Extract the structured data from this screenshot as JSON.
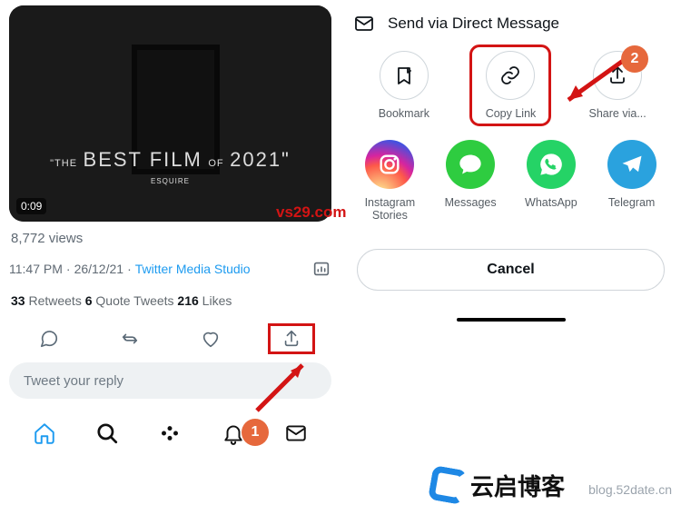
{
  "video": {
    "duration": "0:09",
    "overlay_line1": "\"THE",
    "overlay_line2": "BEST FILM",
    "overlay_line3": "OF",
    "overlay_year": "2021\"",
    "overlay_sub": "ESQUIRE"
  },
  "tweet": {
    "views": "8,772 views",
    "time": "11:47 PM",
    "sep": " · ",
    "date": "26/12/21",
    "source": "Twitter Media Studio",
    "retweets_n": "33",
    "retweets_l": " Retweets ",
    "quotes_n": "6",
    "quotes_l": " Quote Tweets ",
    "likes_n": "216",
    "likes_l": " Likes"
  },
  "reply_placeholder": "Tweet your reply",
  "share": {
    "dm": "Send via Direct Message",
    "bookmark": "Bookmark",
    "copylink": "Copy Link",
    "sharevia": "Share via...",
    "ig": "Instagram Stories",
    "msg": "Messages",
    "wa": "WhatsApp",
    "tg": "Telegram",
    "cancel": "Cancel"
  },
  "annot": {
    "step1": "1",
    "step2": "2"
  },
  "watermark": {
    "a": "vs29.com",
    "b": "blog.52date.cn",
    "c": "云启博客"
  }
}
